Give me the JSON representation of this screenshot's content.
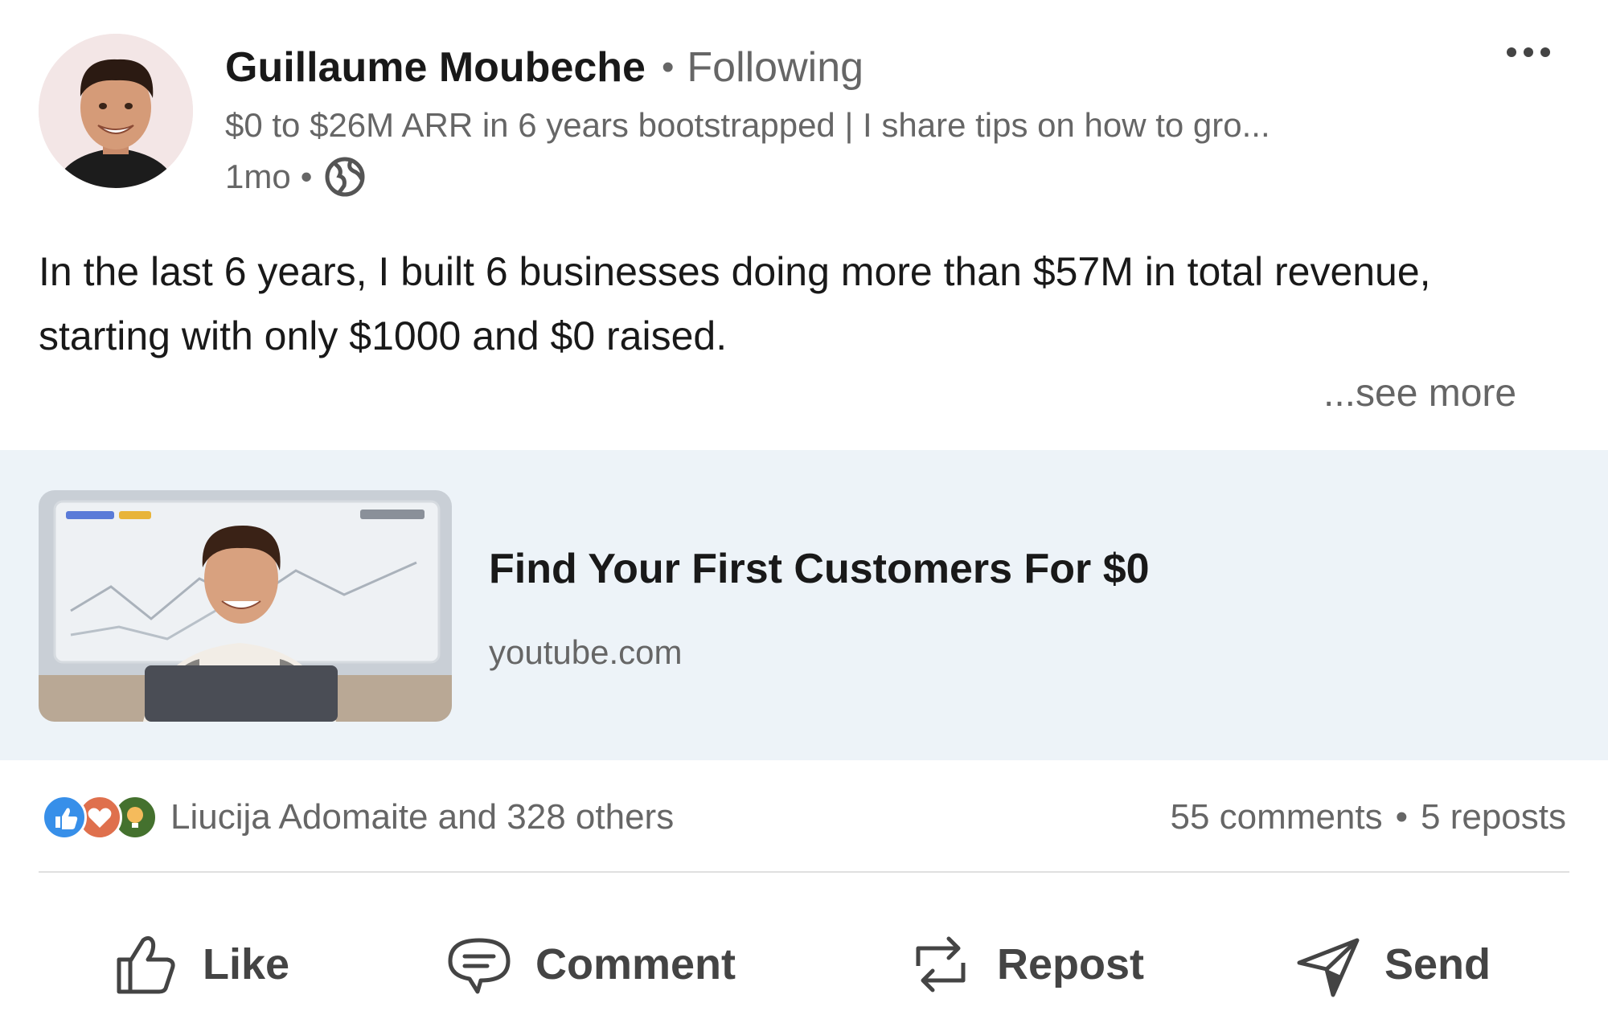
{
  "post": {
    "author": {
      "name": "Guillaume Moubeche",
      "separator": "•",
      "follow_status": "Following",
      "headline": "$0 to $26M ARR in 6 years bootstrapped | I share tips on how to gro...",
      "time": "1mo",
      "time_separator": "•",
      "visibility_icon": "globe-icon"
    },
    "more_icon": "ellipsis-icon",
    "body": {
      "text": "In the last 6 years, I built 6 businesses doing more than $57M in total revenue, starting with only $1000 and $0 raised.",
      "see_more": "...see more"
    },
    "link_preview": {
      "title": "Find Your First Customers For $0",
      "domain": "youtube.com"
    },
    "social": {
      "reaction_icons": [
        "like-reaction-icon",
        "love-reaction-icon",
        "insightful-reaction-icon"
      ],
      "reactions_label": "Liucija Adomaite and 328 others",
      "comments": "55 comments",
      "separator": "•",
      "reposts": "5 reposts"
    },
    "actions": {
      "like": "Like",
      "comment": "Comment",
      "repost": "Repost",
      "send": "Send"
    }
  },
  "colors": {
    "text_primary": "#191919",
    "text_secondary": "#666666",
    "preview_bg": "#edf3f8",
    "like_blue": "#378fe9",
    "love_red": "#df704d",
    "insightful_green": "#44712e"
  }
}
